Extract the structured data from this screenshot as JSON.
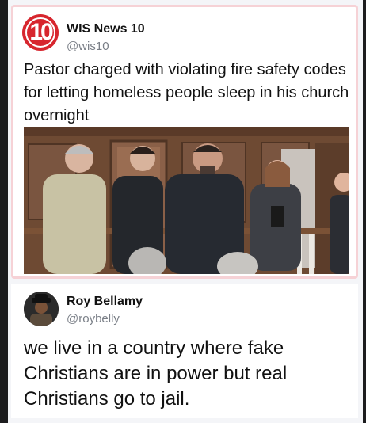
{
  "original_post": {
    "avatar_text": "10",
    "display_name": "WIS News 10",
    "handle": "@wis10",
    "text": "Pastor charged with violating fire safety codes for letting homeless people sleep in his church overnight",
    "brand_color": "#d7262e"
  },
  "reply_post": {
    "display_name": "Roy Bellamy",
    "handle": "@roybelly",
    "text": "we live in a country where fake Christians are in power but real Christians go to jail."
  },
  "colors": {
    "frame_border": "#f6d2d6",
    "handle_gray": "#7a7f87"
  }
}
